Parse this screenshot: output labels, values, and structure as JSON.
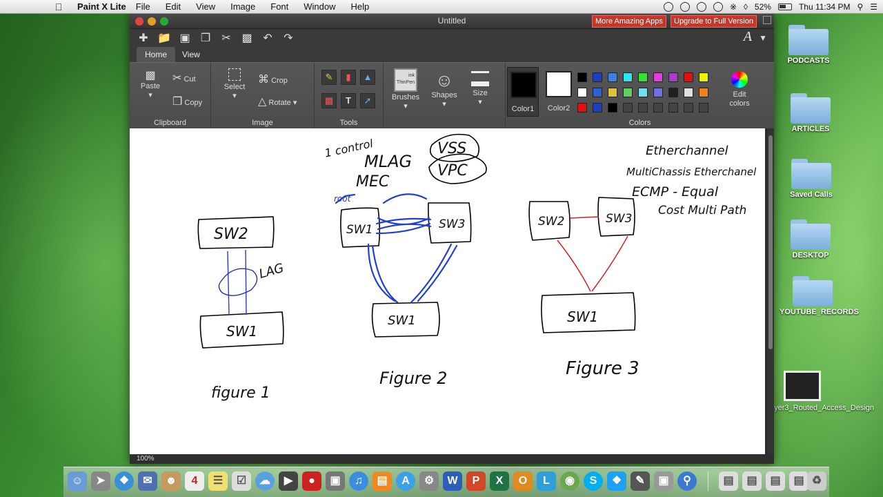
{
  "menubar": {
    "app_name": "Paint X Lite",
    "menus": [
      "File",
      "Edit",
      "View",
      "Image",
      "Font",
      "Window",
      "Help"
    ],
    "battery": "52%",
    "clock": "Thu 11:34 PM"
  },
  "window": {
    "title": "Untitled",
    "promo_more_apps": "More Amazing Apps",
    "promo_upgrade": "Upgrade to Full Version",
    "tabs": [
      "Home",
      "View"
    ],
    "zoom": "100%"
  },
  "ribbon": {
    "clipboard": {
      "label": "Clipboard",
      "paste": "Paste",
      "cut": "Cut",
      "copy": "Copy"
    },
    "image": {
      "label": "Image",
      "select": "Select",
      "crop": "Crop",
      "rotate": "Rotate"
    },
    "tools": {
      "label": "Tools",
      "text_tool": "T"
    },
    "brushes": {
      "label": "Brushes",
      "thumb_top": "ink",
      "thumb_name": "ThinPen"
    },
    "shapes": {
      "label": "Shapes"
    },
    "size": {
      "label": "Size"
    },
    "colors": {
      "label": "Colors",
      "color1": "Color1",
      "color2": "Color2",
      "edit_colors": "Edit colors",
      "color1_value": "#000000",
      "color2_value": "#ffffff",
      "palette": [
        [
          "#000000",
          "#1f3fbf",
          "#3f7fdf",
          "#33e0f0",
          "#33e033",
          "#e040e0",
          "#a040c0",
          "#e01010",
          "#f0f000"
        ],
        [
          "#ffffff",
          "#3060d0",
          "#e0c040",
          "#60d060",
          "#70e0f0",
          "#7070e0",
          "#202020",
          "#e0e0e0",
          "#f08020"
        ],
        [
          "#e01010",
          "#1f3fbf",
          "#000000",
          "#444444",
          "#444444",
          "#444444",
          "#444444",
          "#444444",
          "#444444"
        ]
      ]
    }
  },
  "drawing": {
    "fig1": {
      "top": "SW2",
      "bottom": "SW1",
      "lag": "LAG",
      "caption": "figure 1"
    },
    "fig2": {
      "left": "SW1",
      "right": "SW3",
      "bottom": "SW1",
      "root": "root",
      "caption": "Figure 2"
    },
    "fig3": {
      "left": "SW2",
      "right": "SW3",
      "bottom": "SW1",
      "caption": "Figure 3"
    },
    "notes": {
      "top_left": "1 control",
      "mlag": "MLAG",
      "mec": "MEC",
      "vss": "VSS",
      "vpc": "VPC",
      "etherchannel": "Etherchannel",
      "multichassis": "MultiChassis Etherchanel",
      "ecmp": "ECMP - Equal",
      "costmulti": "Cost Multi Path"
    }
  },
  "desktop": {
    "icons": [
      "PODCASTS",
      "ARTICLES",
      "Saved Calls",
      "DESKTOP",
      "YOUTUBE_RECORDS"
    ],
    "file_icon": "ayer3_Routed_Access_Design"
  },
  "dock": {
    "letters": [
      "W",
      "P",
      "X",
      "O",
      "L"
    ]
  }
}
